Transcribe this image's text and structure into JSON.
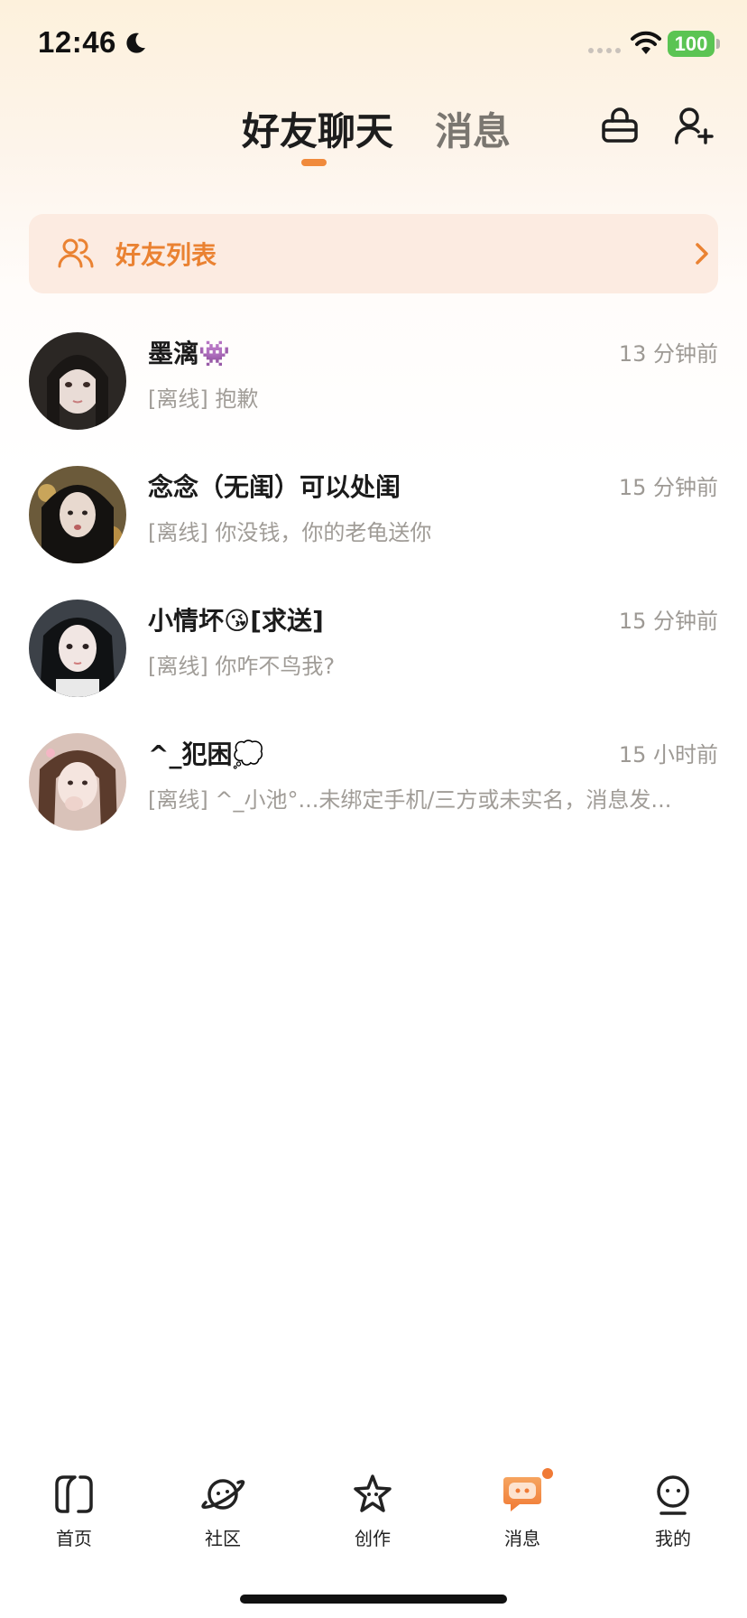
{
  "status_bar": {
    "time": "12:46",
    "battery": "100",
    "battery_color": "#5bc453"
  },
  "header": {
    "tabs": [
      {
        "label": "好友聊天",
        "active": true
      },
      {
        "label": "消息",
        "active": false
      }
    ],
    "accent_color": "#f08a3c",
    "icons": [
      "basket-icon",
      "add-friend-icon"
    ]
  },
  "friend_list_banner": {
    "label": "好友列表",
    "icon": "friends-icon",
    "color": "#ea8232"
  },
  "chats": [
    {
      "name": "墨漓👾",
      "time": "13 分钟前",
      "preview": "[离线] 抱歉"
    },
    {
      "name": "念念（无闺）可以处闺",
      "time": "15 分钟前",
      "preview": "[离线] 你没钱，你的老龟送你"
    },
    {
      "name": "小情坏😘[求送]",
      "time": "15 分钟前",
      "preview": "[离线] 你咋不鸟我?"
    },
    {
      "name": "^_犯困💭",
      "time": "15 小时前",
      "preview": "[离线] ^_小池°...未绑定手机/三方或未实名，消息发..."
    }
  ],
  "bottom_nav": [
    {
      "label": "首页",
      "icon": "home-icon",
      "active": false
    },
    {
      "label": "社区",
      "icon": "planet-icon",
      "active": false
    },
    {
      "label": "创作",
      "icon": "star-icon",
      "active": false
    },
    {
      "label": "消息",
      "icon": "message-icon",
      "active": true,
      "badge": true
    },
    {
      "label": "我的",
      "icon": "profile-icon",
      "active": false
    }
  ]
}
